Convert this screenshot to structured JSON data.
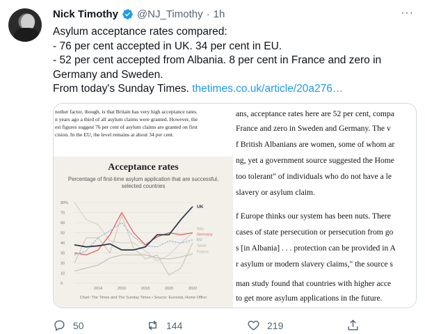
{
  "tweet": {
    "name": "Nick Timothy",
    "handle": "@NJ_Timothy",
    "separator": "·",
    "time": "1h",
    "more": "···",
    "lines": [
      "Asylum acceptance rates compared:",
      "- 76 per cent accepted in UK. 34 per cent in EU.",
      "- 52 per cent accepted from Albania. 8 per cent in France and zero in",
      "Germany and Sweden."
    ],
    "last_line_prefix": "From today's Sunday Times. ",
    "link_text": "thetimes.co.uk/article/20a276…"
  },
  "article_left": [
    "nother factor, though, is that Britain has very high acceptance rates.",
    "n years ago a third of all asylum claims were granted. However, the",
    "est figures suggest 76 per cent of asylum claims are granted on first",
    "cision. In the EU, the level remains at about 34 per cent."
  ],
  "article_right": [
    "ans, acceptance rates here are 52 per cent, compa",
    "France and zero in Sweden and Germany. The v",
    "f British Albanians are women, some of whom ar",
    "ng, yet a government source suggested the Home",
    "too tolerant\" of individuals who do not have a le",
    "slavery or asylum claim.",
    "f Europe thinks our system has been nuts. There",
    "cases of state persecution or persecution from go",
    "s [in Albania] . . . protection can be provided in A",
    "r asylum or modern slavery claims,\" the source s",
    "man study found that countries with higher acce",
    "to get more asylum applications in the future."
  ],
  "chart_panel": {
    "title": "Acceptance rates",
    "subtitle": "Percentage of first-time asylum application that are successful, selected countries",
    "source": "Chart: The Times and The Sunday Times • Source: Eurostat, Home Office"
  },
  "chart_data": {
    "type": "line",
    "title": "Acceptance rates",
    "subtitle": "Percentage of first-time asylum application that are successful, selected countries",
    "ylim": [
      0,
      80
    ],
    "yticks": [
      "80%",
      "70",
      "60",
      "50",
      "40",
      "30",
      "20",
      "10",
      "0"
    ],
    "xticks": [
      "2014",
      "2016",
      "2018",
      "2020",
      "2022"
    ],
    "x": [
      2012,
      2013,
      2014,
      2015,
      2016,
      2017,
      2018,
      2019,
      2020,
      2021,
      2022
    ],
    "series": [
      {
        "name": "UK",
        "color": "#2b3a4a",
        "values": [
          38,
          36,
          37,
          39,
          33,
          33,
          36,
          48,
          48,
          63,
          76
        ]
      },
      {
        "name": "Italy",
        "color": "#d8d4cc",
        "values": [
          80,
          63,
          58,
          42,
          40,
          40,
          32,
          22,
          28,
          40,
          50
        ]
      },
      {
        "name": "Germany",
        "color": "#e15759",
        "values": [
          30,
          28,
          33,
          48,
          70,
          50,
          38,
          46,
          50,
          48,
          50
        ]
      },
      {
        "name": "EU",
        "color": "#8fb4d9",
        "values": [
          28,
          32,
          45,
          52,
          60,
          46,
          37,
          36,
          42,
          40,
          43
        ]
      },
      {
        "name": "Spain",
        "color": "#cfc8bc",
        "values": [
          20,
          45,
          45,
          30,
          67,
          35,
          24,
          28,
          8,
          15,
          40
        ]
      },
      {
        "name": "France",
        "color": "#c6c0b5",
        "values": [
          12,
          15,
          18,
          25,
          28,
          28,
          28,
          25,
          24,
          26,
          29
        ]
      }
    ]
  },
  "actions": {
    "reply_count": "50",
    "retweet_count": "144",
    "like_count": "219"
  },
  "colors": {
    "link": "#1d9bf0",
    "muted": "#536471",
    "verified": "#1d9bf0"
  }
}
